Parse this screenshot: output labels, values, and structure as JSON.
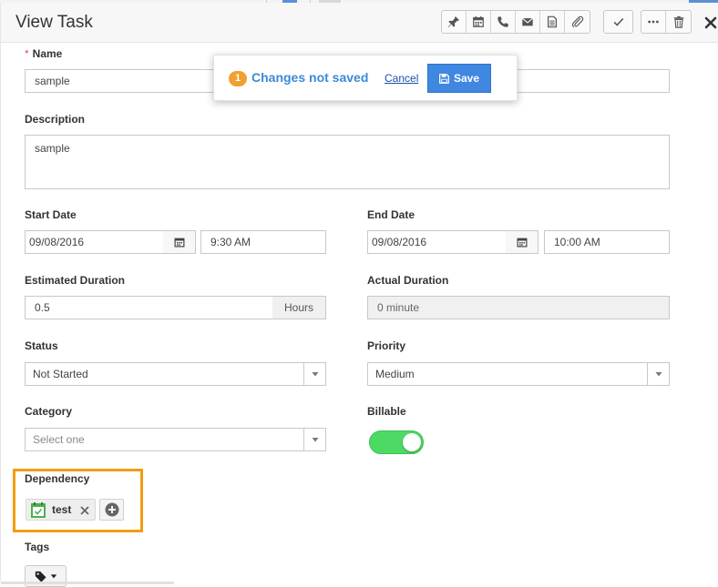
{
  "header": {
    "title": "View Task",
    "toolbar_icons": [
      "pin-icon",
      "calendar-icon",
      "phone-icon",
      "mail-icon",
      "document-icon",
      "paperclip-icon",
      "check-icon",
      "more-icon",
      "trash-icon",
      "close-icon"
    ]
  },
  "notice": {
    "count": "1",
    "message": "Changes not saved",
    "cancel_label": "Cancel",
    "save_label": "Save"
  },
  "form": {
    "name": {
      "label": "Name",
      "required_mark": "*",
      "value": "sample"
    },
    "description": {
      "label": "Description",
      "value": "sample"
    },
    "start_date": {
      "label": "Start Date",
      "date": "09/08/2016",
      "time": "9:30 AM"
    },
    "end_date": {
      "label": "End Date",
      "date": "09/08/2016",
      "time": "10:00 AM"
    },
    "estimated_duration": {
      "label": "Estimated Duration",
      "value": "0.5",
      "unit": "Hours"
    },
    "actual_duration": {
      "label": "Actual Duration",
      "value": "0 minute"
    },
    "status": {
      "label": "Status",
      "value": "Not Started"
    },
    "priority": {
      "label": "Priority",
      "value": "Medium"
    },
    "category": {
      "label": "Category",
      "placeholder": "Select one"
    },
    "billable": {
      "label": "Billable",
      "on": true
    },
    "dependency": {
      "label": "Dependency",
      "items": [
        {
          "name": "test"
        }
      ]
    },
    "tags": {
      "label": "Tags"
    }
  },
  "colors": {
    "accent": "#3f87e0",
    "highlight_box": "#f39c12",
    "toggle_on": "#4cd964",
    "badge": "#f0a030"
  }
}
